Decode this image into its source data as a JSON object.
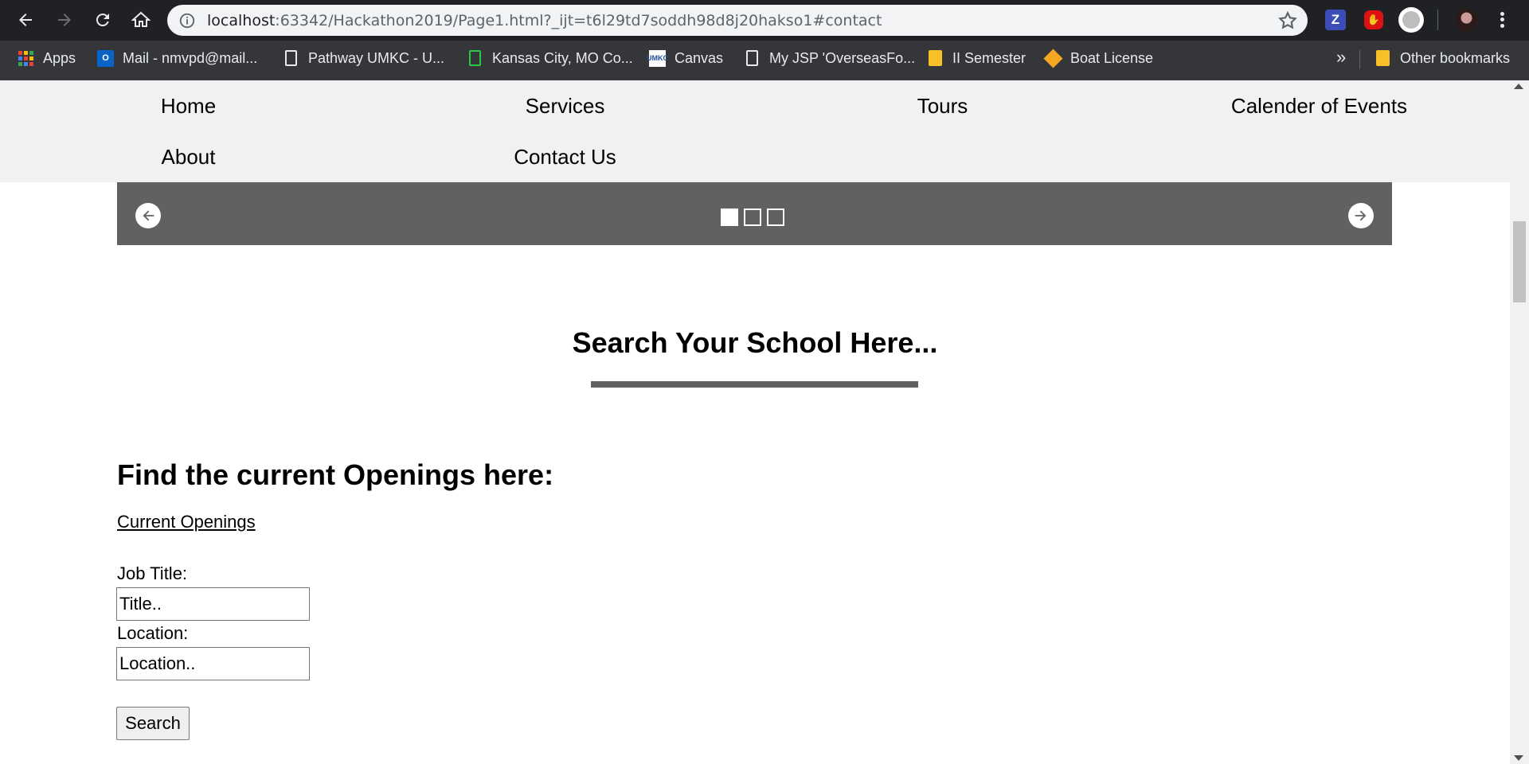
{
  "browser": {
    "url_host": "localhost",
    "url_rest": ":63342/Hackathon2019/Page1.html?_ijt=t6l29td7soddh98d8j20hakso1#contact",
    "bookmarks": [
      {
        "label": "Apps",
        "icon": "apps-grid-icon"
      },
      {
        "label": "Mail - nmvpd@mail...",
        "icon": "outlook-icon"
      },
      {
        "label": "Pathway UMKC - U...",
        "icon": "page-icon"
      },
      {
        "label": "Kansas City, MO Co...",
        "icon": "green-doc-icon"
      },
      {
        "label": "Canvas",
        "icon": "umkc-icon"
      },
      {
        "label": "My JSP 'OverseasFo...",
        "icon": "page-icon"
      },
      {
        "label": "II Semester",
        "icon": "folder-icon"
      },
      {
        "label": "Boat License",
        "icon": "diamond-icon"
      }
    ],
    "more_bookmarks": "»",
    "other_bookmarks": "Other bookmarks",
    "ext_z_label": "Z",
    "ext_stop_label": "✋"
  },
  "nav": {
    "home": "Home",
    "services": "Services",
    "tours": "Tours",
    "events": "Calender of Events",
    "about": "About",
    "contact": "Contact Us"
  },
  "slider": {
    "dots": 3,
    "active_dot": 1
  },
  "search_section": {
    "title": "Search Your School Here..."
  },
  "openings": {
    "heading": "Find the current Openings here:",
    "link": "Current Openings",
    "job_title_label": "Job Title:",
    "job_title_placeholder": "Title..",
    "location_label": "Location:",
    "location_placeholder": "Location..",
    "search_button": "Search"
  },
  "colors": {
    "chrome_dark": "#202124",
    "bookmarks_bar": "#35363a",
    "nav_bg": "#f1f1f1",
    "slider_bg": "#616161"
  }
}
